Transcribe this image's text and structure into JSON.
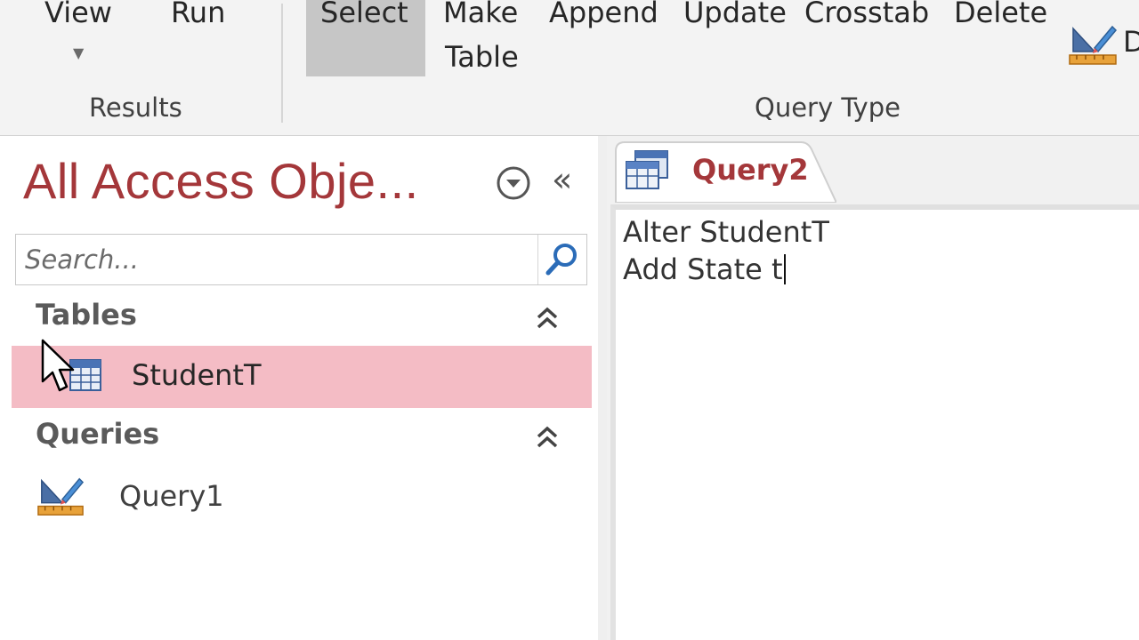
{
  "ribbon": {
    "results_group": {
      "label": "Results",
      "view_label": "View",
      "run_label": "Run"
    },
    "query_type_group": {
      "label": "Query Type",
      "select_label": "Select",
      "make_table_label_1": "Make",
      "make_table_label_2": "Table",
      "append_label": "Append",
      "update_label": "Update",
      "crosstab_label": "Crosstab",
      "delete_label": "Delete",
      "selected": "Select"
    },
    "cutoff_label": "D"
  },
  "nav_pane": {
    "title": "All Access Obje...",
    "search_placeholder": "Search...",
    "sections": [
      {
        "header": "Tables",
        "items": [
          {
            "label": "StudentT",
            "icon": "table-icon",
            "selected": true
          }
        ]
      },
      {
        "header": "Queries",
        "items": [
          {
            "label": "Query1",
            "icon": "query-design-icon",
            "selected": false
          }
        ]
      }
    ]
  },
  "document": {
    "tab_label": "Query2",
    "sql_lines": [
      "Alter StudentT",
      "Add State t"
    ]
  },
  "colors": {
    "accent": "#a4373a",
    "selected_row": "#f4bcc5",
    "ribbon_bg": "#f3f3f3",
    "select_highlight": "#c6c6c6"
  }
}
